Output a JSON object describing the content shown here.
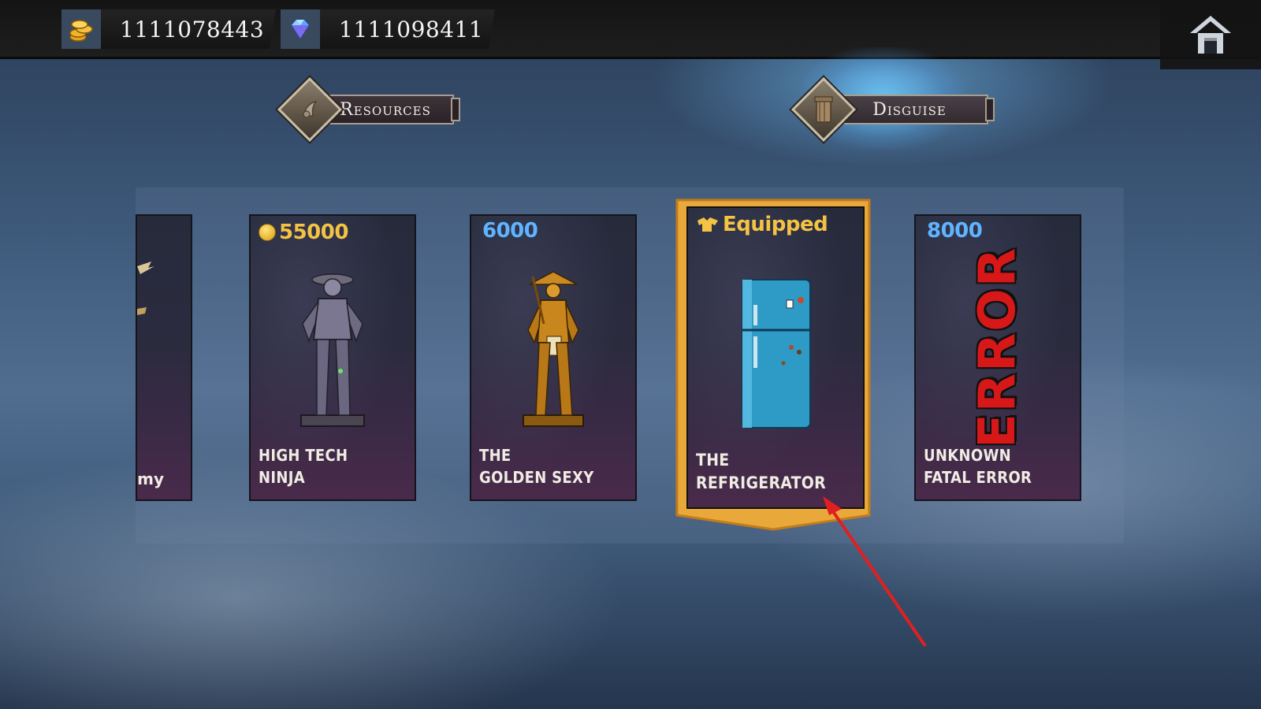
{
  "currency": {
    "coins": "1111078443",
    "gems": "1111098411",
    "coin_icon": "coin-stack-icon",
    "gem_icon": "diamond-gem-icon"
  },
  "home_icon": "home-icon",
  "tabs": [
    {
      "label": "Resources",
      "icon": "resource-icon",
      "active": false
    },
    {
      "label": "Disguise",
      "icon": "disguise-icon",
      "active": true
    }
  ],
  "cards": [
    {
      "name_line2": "mmy",
      "price": "",
      "currency": "",
      "partial": true
    },
    {
      "name_line1": "High Tech",
      "name_line2": "Ninja",
      "price": "55000",
      "currency": "gold"
    },
    {
      "name_line1": "The",
      "name_line2": "Golden Sexy",
      "price": "6000",
      "currency": "gem"
    },
    {
      "name_line1": "The",
      "name_line2": "Refrigerator",
      "status": "Equipped",
      "currency": "equipped"
    },
    {
      "name_line1": "Unknown",
      "name_line2": "Fatal Error",
      "price": "8000",
      "currency": "gem",
      "art_text": "ERROR"
    }
  ],
  "colors": {
    "gold_price": "#f5c343",
    "gem_price": "#5fb4ff",
    "equipped_border": "#e9a93a",
    "arrow": "#e02020"
  }
}
